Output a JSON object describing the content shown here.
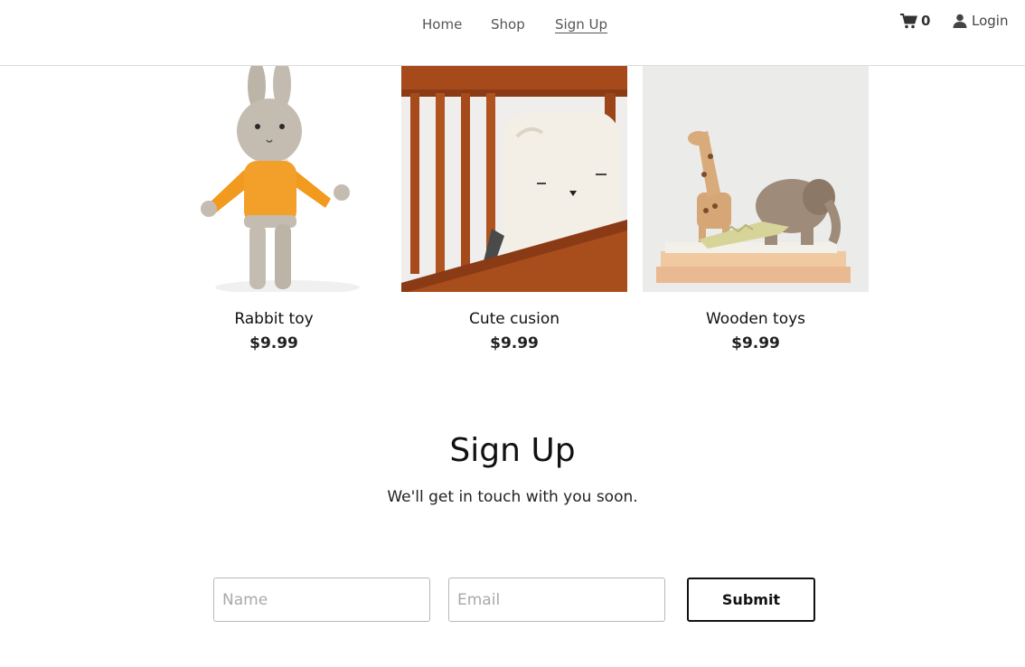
{
  "nav": {
    "links": [
      {
        "label": "Home"
      },
      {
        "label": "Shop"
      },
      {
        "label": "Sign Up",
        "active": true
      }
    ],
    "cart": {
      "icon": "shopping-cart-icon",
      "count": "0"
    },
    "login": {
      "icon": "user-icon",
      "label": "Login"
    }
  },
  "products": [
    {
      "name": "Rabbit toy",
      "price": "$9.99"
    },
    {
      "name": "Cute cusion",
      "price": "$9.99"
    },
    {
      "name": "Wooden toys",
      "price": "$9.99"
    }
  ],
  "signup": {
    "title": "Sign Up",
    "subtitle": "We'll get in touch with you soon.",
    "name_placeholder": "Name",
    "email_placeholder": "Email",
    "submit_label": "Submit"
  },
  "colors": {
    "border": "#dcdcdc",
    "nav_text": "#555555",
    "accent_orange": "#f19a1e"
  }
}
